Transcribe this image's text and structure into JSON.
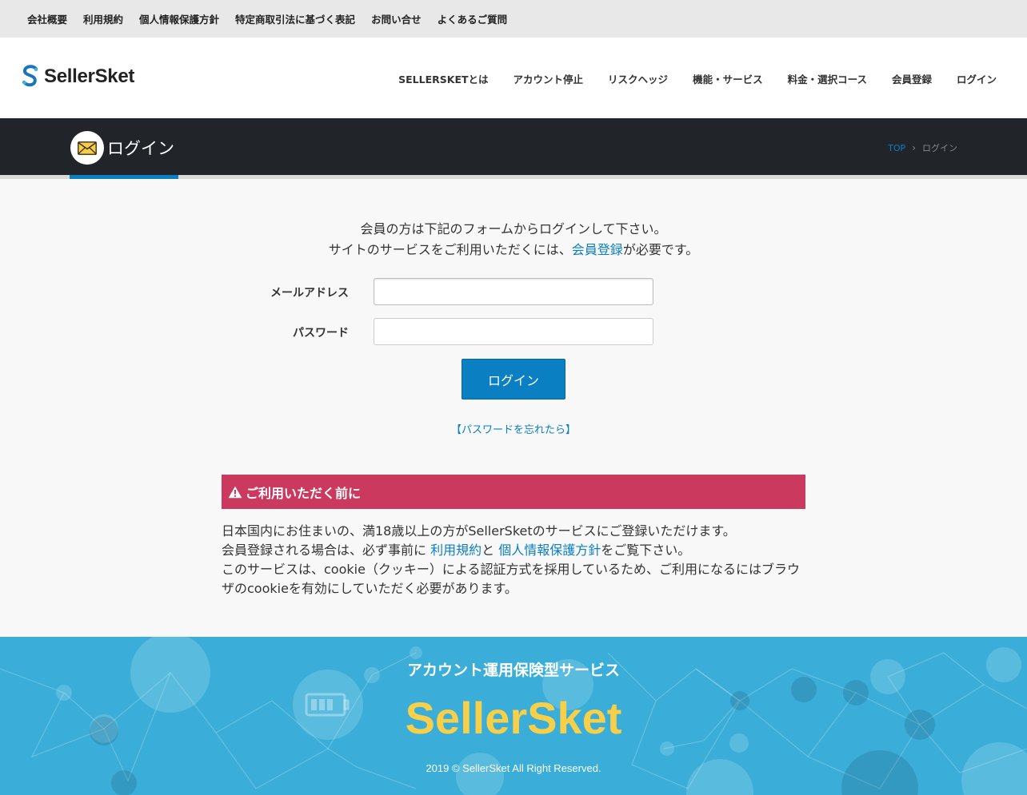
{
  "utility_nav": [
    "会社概要",
    "利用規約",
    "個人情報保護方針",
    "特定商取引法に基づく表記",
    "お問い合せ",
    "よくあるご質問"
  ],
  "brand": {
    "name": "SellerSket"
  },
  "main_nav": [
    "SELLERSKETとは",
    "アカウント停止",
    "リスクヘッジ",
    "機能・サービス",
    "料金・選択コース",
    "会員登録",
    "ログイン"
  ],
  "page": {
    "title": "ログイン",
    "title_icon": "envelope-icon",
    "breadcrumb": {
      "top": "TOP",
      "separator": "›",
      "current": "ログイン"
    }
  },
  "intro": {
    "line1": "会員の方は下記のフォームからログインして下さい。",
    "line2_before": "サイトのサービスをご利用いただくには、",
    "line2_link": "会員登録",
    "line2_after": "が必要です。"
  },
  "form": {
    "email_label": "メールアドレス",
    "email_value": "",
    "password_label": "パスワード",
    "password_value": "",
    "submit_label": "ログイン",
    "forgot_label": "【パスワードを忘れたら】"
  },
  "notice": {
    "heading": "ご利用いただく前に",
    "line1": "日本国内にお住まいの、満18歳以上の方がSellerSketのサービスにご登録いただけます。",
    "line2_before": "会員登録される場合は、必ず事前に ",
    "line2_link1": "利用規約",
    "line2_mid": "と ",
    "line2_link2": "個人情報保護方針",
    "line2_after": "をご覧下さい。",
    "line3": "このサービスは、cookie（クッキー）による認証方式を採用しているため、ご利用になるにはブラウザのcookieを有効にしていただく必要があります。"
  },
  "footer": {
    "tagline": "アカウント運用保険型サービス",
    "brand": "SellerSket",
    "copyright": "2019 © SellerSket All Right Reserved."
  },
  "colors": {
    "accent": "#0a7fc2",
    "title_band": "#212529",
    "notice": "#cb3a5e",
    "footer_bg": "#3aaed8",
    "footer_brand": "#f7cf48"
  }
}
